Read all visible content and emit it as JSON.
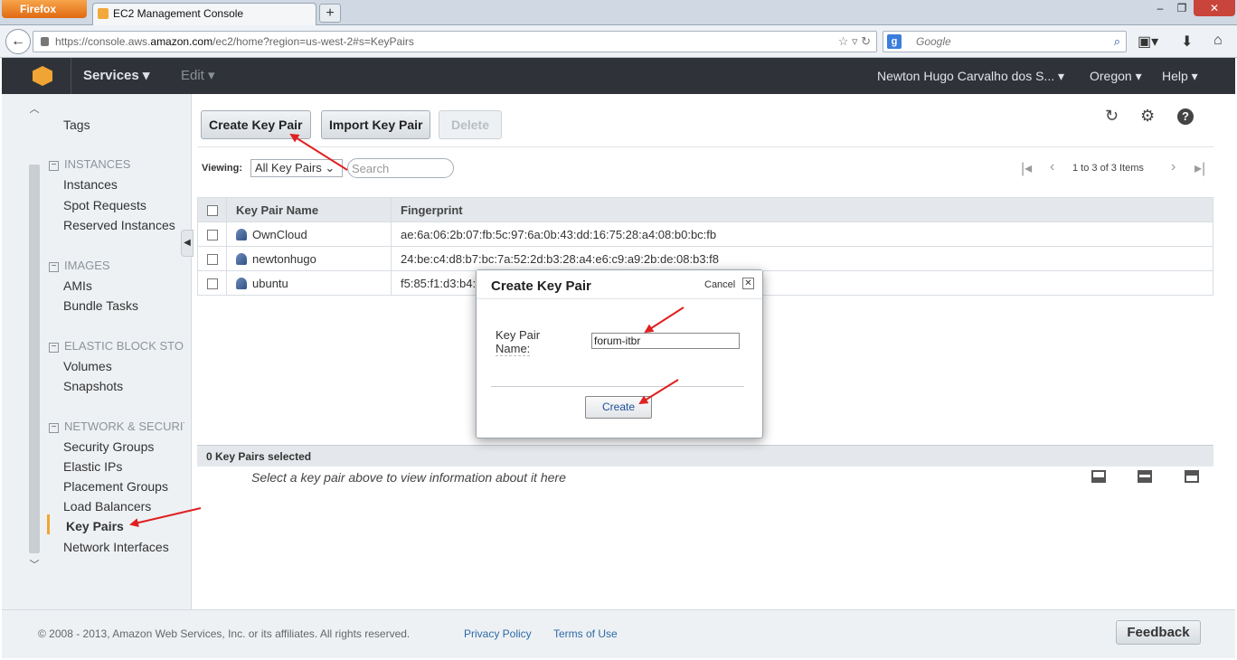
{
  "browser": {
    "app_button": "Firefox",
    "tab_title": "EC2 Management Console",
    "new_tab": "+",
    "url_prefix": "https://console.aws.",
    "url_domain": "amazon.com",
    "url_suffix": "/ec2/home?region=us-west-2#s=KeyPairs",
    "search_placeholder": "Google",
    "search_engine_icon": "g-icon"
  },
  "header": {
    "services": "Services ▾",
    "edit": "Edit ▾",
    "user": "Newton Hugo Carvalho dos S... ▾",
    "region": "Oregon ▾",
    "help": "Help ▾",
    "accent": "#f0a434"
  },
  "sidebar": {
    "tags": "Tags",
    "sections": [
      {
        "title": "INSTANCES",
        "items": [
          "Instances",
          "Spot Requests",
          "Reserved Instances"
        ]
      },
      {
        "title": "IMAGES",
        "items": [
          "AMIs",
          "Bundle Tasks"
        ]
      },
      {
        "title": "ELASTIC BLOCK STORE",
        "items": [
          "Volumes",
          "Snapshots"
        ]
      },
      {
        "title": "NETWORK & SECURITY",
        "items": [
          "Security Groups",
          "Elastic IPs",
          "Placement Groups",
          "Load Balancers",
          "Key Pairs",
          "Network Interfaces"
        ]
      }
    ],
    "active_item": "Key Pairs"
  },
  "toolbar": {
    "create": "Create Key Pair",
    "import": "Import Key Pair",
    "delete": "Delete",
    "viewing_label": "Viewing:",
    "viewing_value": "All Key Pairs",
    "search_placeholder": "Search",
    "pagination": "1 to 3 of 3 Items"
  },
  "table": {
    "columns": [
      "Key Pair Name",
      "Fingerprint"
    ],
    "rows": [
      {
        "name": "OwnCloud",
        "fingerprint": "ae:6a:06:2b:07:fb:5c:97:6a:0b:43:dd:16:75:28:a4:08:b0:bc:fb"
      },
      {
        "name": "newtonhugo",
        "fingerprint": "24:be:c4:d8:b7:bc:7a:52:2d:b3:28:a4:e6:c9:a9:2b:de:08:b3:f8"
      },
      {
        "name": "ubuntu",
        "fingerprint": "f5:85:f1:d3:b4:"
      }
    ]
  },
  "detail": {
    "count": "0 Key Pairs selected",
    "message": "Select a key pair above to view information about it here"
  },
  "modal": {
    "title": "Create Key Pair",
    "cancel": "Cancel",
    "close": "✕",
    "label_line1": "Key Pair",
    "label_line2": "Name:",
    "input_value": "forum-itbr",
    "create": "Create"
  },
  "footer": {
    "copyright": "© 2008 - 2013, Amazon Web Services, Inc. or its affiliates. All rights reserved.",
    "privacy": "Privacy Policy",
    "terms": "Terms of Use",
    "feedback": "Feedback"
  },
  "annotation_color": "#e02020"
}
